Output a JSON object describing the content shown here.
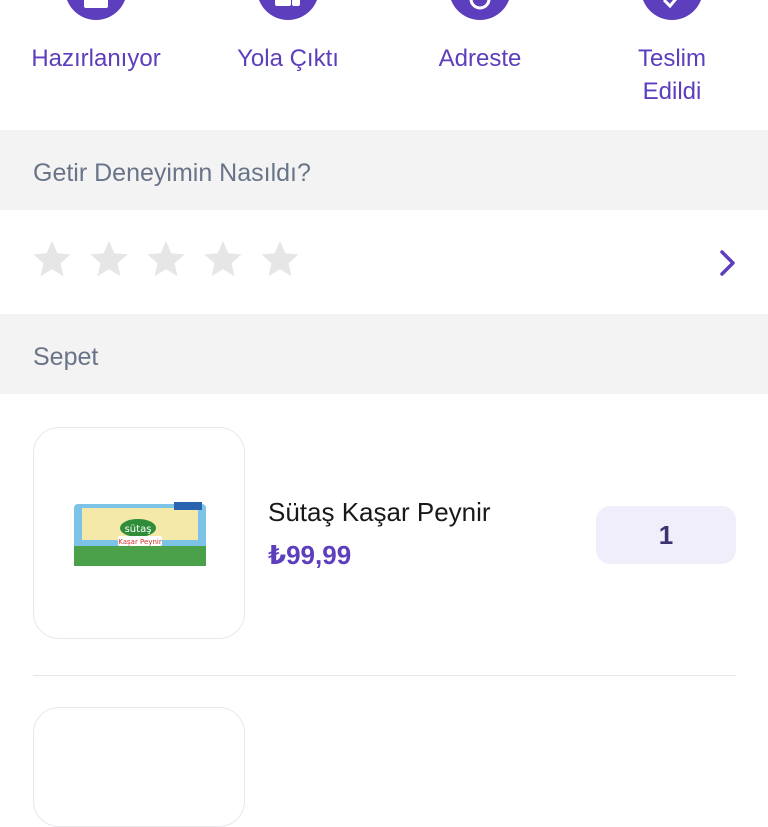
{
  "status_steps": [
    {
      "label": "Hazırlanıyor",
      "icon": "package-icon"
    },
    {
      "label": "Yola Çıktı",
      "icon": "truck-icon"
    },
    {
      "label": "Adreste",
      "icon": "location-icon"
    },
    {
      "label": "Teslim\nEdildi",
      "icon": "check-icon"
    }
  ],
  "rating": {
    "title": "Getir Deneyimin Nasıldı?",
    "stars_filled": 0,
    "stars_total": 5,
    "star_color": "#e6e6e6"
  },
  "cart": {
    "title": "Sepet",
    "items": [
      {
        "name": "Sütaş Kaşar Peynir",
        "price": "₺99,99",
        "quantity": "1",
        "package_brand": "sütaş",
        "package_label": "Kaşar Peynir"
      }
    ]
  },
  "colors": {
    "brand": "#5d3ebc",
    "section_bg": "#f3f3f4",
    "qty_bg": "#f0eefb"
  }
}
